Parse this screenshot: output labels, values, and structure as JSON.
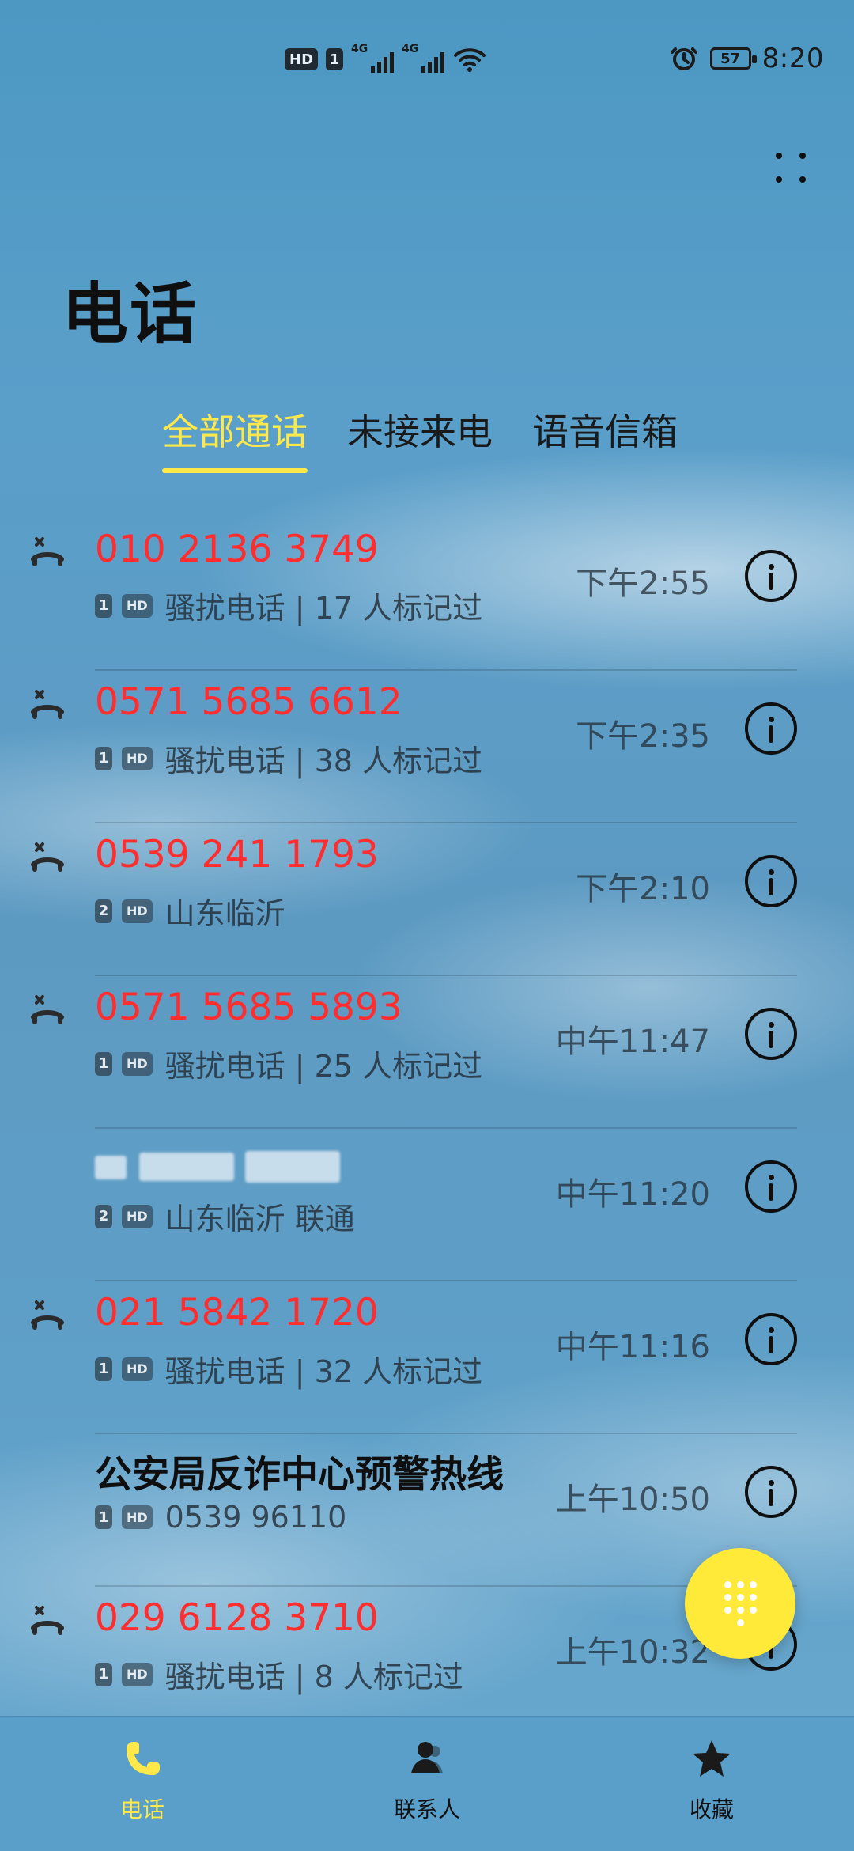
{
  "status_bar": {
    "hd_label": "HD",
    "sim1_label": "1",
    "network_1": "4G",
    "network_2": "4G",
    "battery_level": "57",
    "time": "8:20"
  },
  "header": {
    "title": "电话"
  },
  "tabs": [
    {
      "label": "全部通话",
      "active": true
    },
    {
      "label": "未接来电",
      "active": false
    },
    {
      "label": "语音信箱",
      "active": false
    }
  ],
  "calls": [
    {
      "name": "010 2136 3749",
      "sim": "1",
      "hd": "HD",
      "detail": "骚扰电话 | 17 人标记过",
      "time": "下午2:55",
      "missed": true
    },
    {
      "name": "0571 5685 6612",
      "sim": "1",
      "hd": "HD",
      "detail": "骚扰电话 | 38 人标记过",
      "time": "下午2:35",
      "missed": true
    },
    {
      "name": "0539 241 1793",
      "sim": "2",
      "hd": "HD",
      "detail": "山东临沂",
      "time": "下午2:10",
      "missed": true
    },
    {
      "name": "0571 5685 5893",
      "sim": "1",
      "hd": "HD",
      "detail": "骚扰电话 | 25 人标记过",
      "time": "中午11:47",
      "missed": true
    },
    {
      "name": "",
      "sim": "2",
      "hd": "HD",
      "detail": "山东临沂 联通",
      "time": "中午11:20",
      "missed": false,
      "redacted": true
    },
    {
      "name": "021 5842 1720",
      "sim": "1",
      "hd": "HD",
      "detail": "骚扰电话 | 32 人标记过",
      "time": "中午11:16",
      "missed": true
    },
    {
      "name": "公安局反诈中心预警热线",
      "sim": "1",
      "hd": "HD",
      "detail": "0539 96110",
      "time": "上午10:50",
      "missed": false
    },
    {
      "name": "029 6128 3710",
      "sim": "1",
      "hd": "HD",
      "detail": "骚扰电话 | 8 人标记过",
      "time": "上午10:32",
      "missed": true
    }
  ],
  "bottom_nav": [
    {
      "label": "电话",
      "icon": "phone-icon",
      "active": true
    },
    {
      "label": "联系人",
      "icon": "contacts-icon",
      "active": false
    },
    {
      "label": "收藏",
      "icon": "star-icon",
      "active": false
    }
  ],
  "colors": {
    "accent": "#ffe94a",
    "missed": "#ff2d2d",
    "fab": "#ffea3a"
  },
  "icons": {
    "more": "more-dots-icon",
    "missed_call": "missed-call-icon",
    "info": "info-icon",
    "dialpad": "dialpad-icon"
  }
}
